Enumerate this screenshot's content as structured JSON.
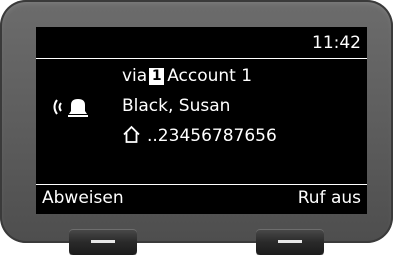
{
  "status": {
    "time": "11:42"
  },
  "call": {
    "via_label": "via",
    "account_number": "1",
    "account_name": "Account 1",
    "caller_name": "Black, Susan",
    "caller_number": "..23456787656"
  },
  "softkeys": {
    "left": "Abweisen",
    "right": "Ruf aus"
  },
  "icons": {
    "ring": "ringing-bell-icon",
    "home": "home-phone-icon",
    "left_key": "left-display-key",
    "right_key": "right-display-key"
  }
}
